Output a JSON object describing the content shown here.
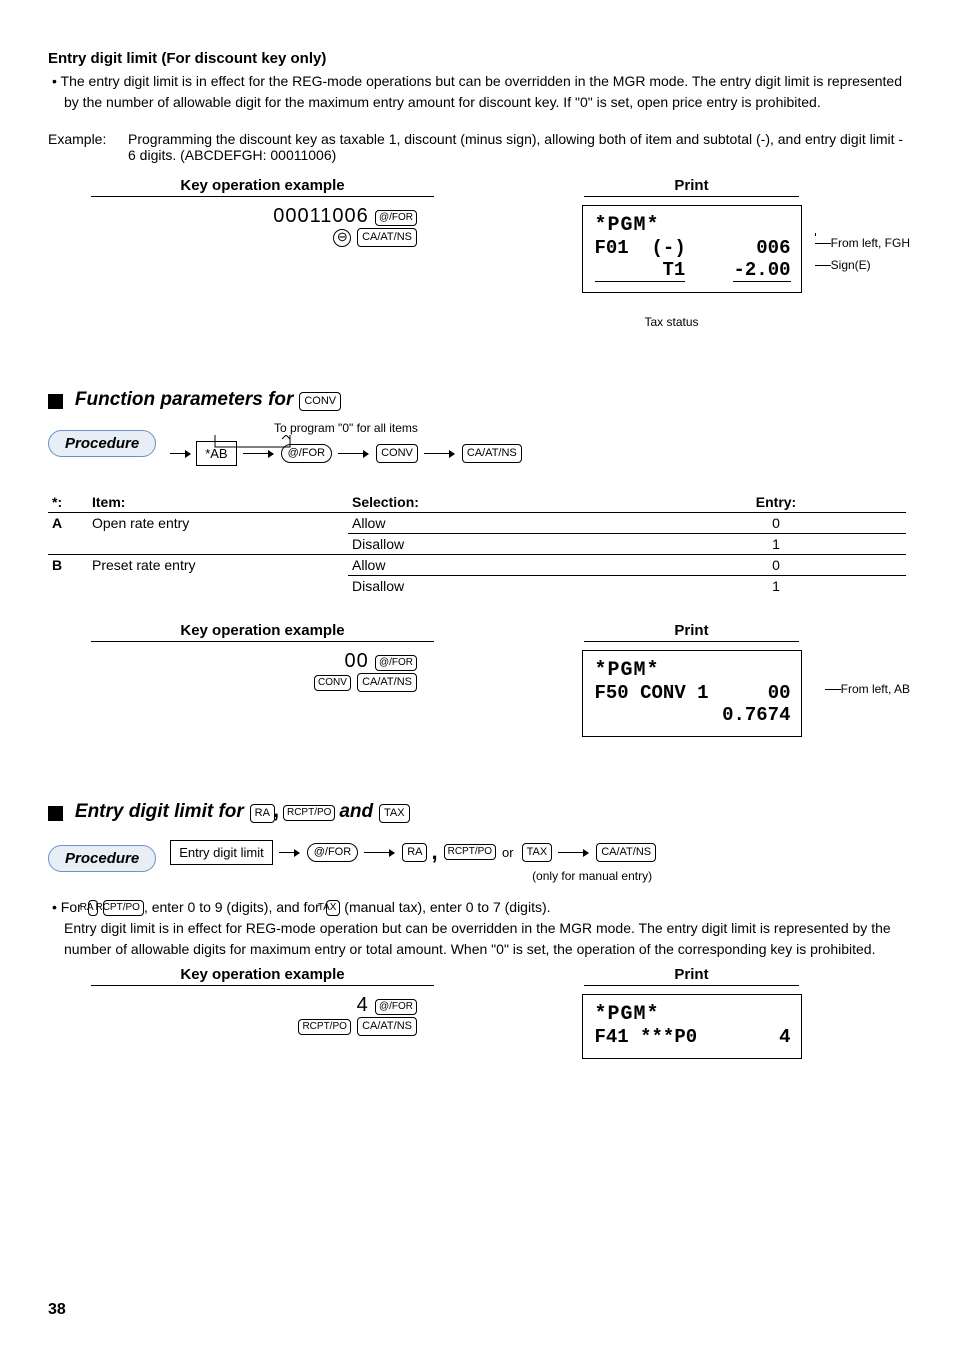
{
  "heading1": "Entry digit limit (For discount key only)",
  "bullet1": "• The entry digit limit is in effect for the REG-mode operations but can be overridden in the MGR mode.  The entry digit limit is represented by the number of allowable digit for the maximum entry amount for discount key.  If \"0\" is set, open price entry is prohibited.",
  "example_label": "Example:",
  "example_text": "Programming the discount key as taxable 1, discount (minus sign), allowing both of item and subtotal (-), and entry digit limit - 6 digits.  (ABCDEFGH: 00011006)",
  "koe_label": "Key operation example",
  "print_label": "Print",
  "ex1": {
    "digits": "00011006",
    "btn1": "@/FOR",
    "btn2_icon": "minus-circle-icon",
    "btn3": "CA/AT/NS",
    "print": {
      "l1": "*PGM*",
      "l2a": "F01",
      "l2b": "(-)",
      "l2c": "006",
      "l3a": "T1",
      "l3b": "-2.00"
    },
    "c1": "From left, FGH",
    "c2": "Sign(E)",
    "c3": "Tax status"
  },
  "func_head_pre": "Function parameters for",
  "func_btn": "CONV",
  "procedure": "Procedure",
  "zero_note": "To program \"0\" for all items",
  "flow1": {
    "box1": "*AB",
    "btn1": "@/FOR",
    "btn2": "CONV",
    "btn3": "CA/AT/NS"
  },
  "table_header": {
    "c0": "*:",
    "c1": "Item:",
    "c2": "Selection:",
    "c3": "Entry:"
  },
  "rows": [
    {
      "k": "A",
      "item": "Open rate entry",
      "sel": "Allow",
      "ent": "0"
    },
    {
      "k": "",
      "item": "",
      "sel": "Disallow",
      "ent": "1"
    },
    {
      "k": "B",
      "item": "Preset rate entry",
      "sel": "Allow",
      "ent": "0"
    },
    {
      "k": "",
      "item": "",
      "sel": "Disallow",
      "ent": "1"
    }
  ],
  "ex2": {
    "digits": "00",
    "btn1": "@/FOR",
    "btn2": "CONV",
    "btn3": "CA/AT/NS",
    "print": {
      "l1": "*PGM*",
      "l2a": "F50 CONV 1",
      "l2b": "00",
      "l3": "0.7674"
    },
    "c1": "From left, AB"
  },
  "edl_head_pre": "Entry digit limit for",
  "edl_b1": "RA",
  "edl_b2": "RCPT/PO",
  "edl_and": "and",
  "edl_b3": "TAX",
  "flow2": {
    "label": "Entry digit limit",
    "btn1": "@/FOR",
    "box1": "RA",
    "box2": "RCPT/PO",
    "or": "or",
    "box3": "TAX",
    "btn2": "CA/AT/NS",
    "note": "(only for manual entry)"
  },
  "edl_bullet_pre": "• For ",
  "edl_bullet_mid": ", enter 0 to 9 (digits), and for ",
  "edl_bullet_post": " (manual tax), enter 0 to 7 (digits).",
  "edl_para": "Entry digit limit is in effect for REG-mode operation but can be overridden in the MGR mode.  The entry digit limit is represented by the number of allowable digits for maximum entry or total amount.  When \"0\" is set, the operation of the corresponding key is prohibited.",
  "ex3": {
    "digits": "4",
    "btn1": "@/FOR",
    "btn2": "RCPT/PO",
    "btn3": "CA/AT/NS",
    "print": {
      "l1": "*PGM*",
      "l2a": "F41 ***P0",
      "l2b": "4"
    }
  },
  "page": "38"
}
